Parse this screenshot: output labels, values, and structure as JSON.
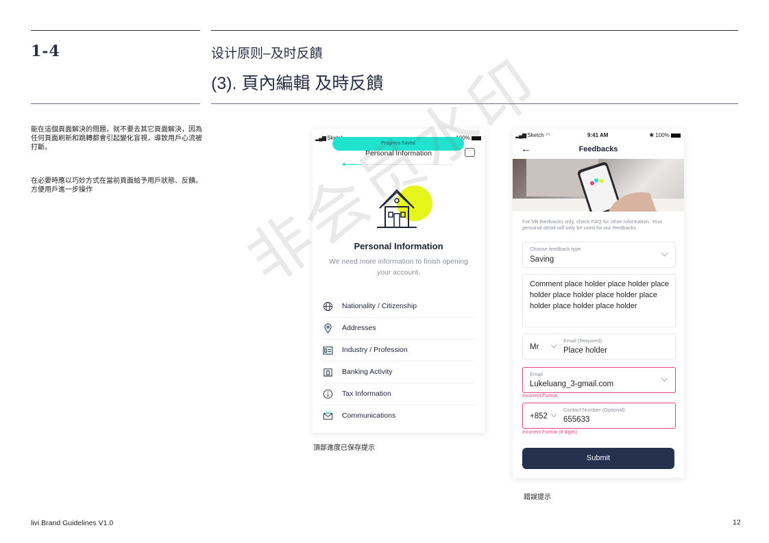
{
  "section_number": "1-4",
  "subtitle": "设计原则–及时反饋",
  "title": "(3). 頁內編輯 及時反饋",
  "description": {
    "paragraph1": "能在這個頁面解決的問題，就不要去其它頁面解決，因為任何頁面刷新和跳轉都會引起變化盲視，導致用戶心流被打斷。",
    "paragraph2": "在必要時應以巧妙方式在當前頁面給予用戶狀態、反饋。方便用戶進一步操作"
  },
  "phone1": {
    "status_left": "Sketch",
    "status_right": "100%",
    "progress_toast": "Progress Saved",
    "header_title": "Personal Information",
    "heading": "Personal Information",
    "body": "We need more information to finish opening your account.",
    "items": [
      {
        "label": "Nationality / Citizenship",
        "icon": "globe-icon"
      },
      {
        "label": "Addresses",
        "icon": "location-pin-icon"
      },
      {
        "label": "Industry / Profession",
        "icon": "id-card-icon"
      },
      {
        "label": "Banking Activity",
        "icon": "bank-icon"
      },
      {
        "label": "Tax Information",
        "icon": "info-icon"
      },
      {
        "label": "Communications",
        "icon": "envelope-icon"
      }
    ],
    "accent_color": "#20e3cf",
    "highlight_color": "#e6f51a"
  },
  "caption1": "頂部進度已保存提示",
  "phone2": {
    "status_carrier": "Sketch",
    "status_time": "9:41 AM",
    "status_battery": "100%",
    "title": "Feedbacks",
    "note": "For VB feedbacks only, check FAQ for other information. Your personal detail will only be used for our feedbacks.",
    "feedback_type_label": "Choose feedback type",
    "feedback_type_value": "Saving",
    "comment_placeholder": "Comment place holder place holder place holder place holder place holder place holder place holder place holder",
    "salutation": "Mr",
    "email_required_label": "Email (Required)",
    "email_required_placeholder": "Place holder",
    "email_label": "Email",
    "email_value": "Lukeluang_3-gmail.com",
    "email_error": "Incorrect Format",
    "phone_code": "+852",
    "contact_label": "Contact Number (Optional)",
    "contact_value": "655633",
    "contact_error": "Incorrect Format (8 digits)",
    "submit_label": "Submit",
    "error_color": "#e4427d",
    "button_color": "#25314f"
  },
  "caption2": "錯誤提示",
  "watermark": "非会员水印",
  "footer_left": "livi Brand Guidelines V1.0",
  "page_number": "12"
}
